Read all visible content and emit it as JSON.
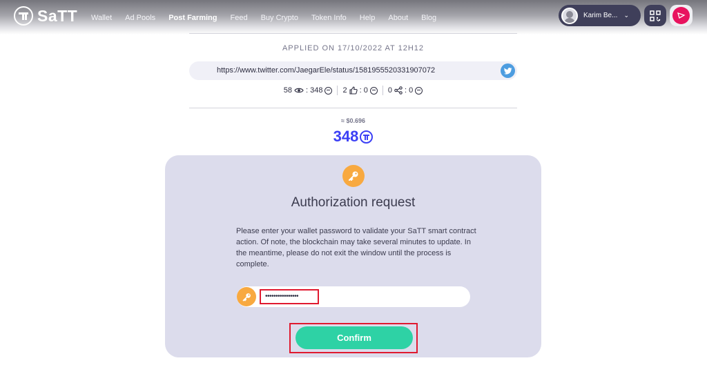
{
  "header": {
    "logo_text": "SaTT",
    "nav": [
      "Wallet",
      "Ad Pools",
      "Post Farming",
      "Feed",
      "Buy Crypto",
      "Token Info",
      "Help",
      "About",
      "Blog"
    ],
    "active_nav": "Post Farming",
    "user_name": "Karim Be...",
    "qr_icon": "qr-code-icon",
    "wallet_icon": "wallet-icon"
  },
  "post": {
    "applied_on": "APPLIED ON 17/10/2022 AT 12H12",
    "url": "https://www.twitter.com/JaegarEle/status/1581955520331907072",
    "network_icon": "twitter-icon",
    "stats": {
      "views": "58",
      "views_reward": "348",
      "likes": "2",
      "likes_reward": "0",
      "shares": "0",
      "shares_reward": "0"
    },
    "usd_value": "≈ $0.696",
    "total_reward": "348"
  },
  "auth": {
    "title": "Authorization request",
    "description": "Please enter your wallet password to validate your SaTT smart contract action. Of note, the blockchain may take several minutes to update. In the meantime, please do not exit the window until the process is complete.",
    "password_value": "••••••••••••••••",
    "confirm_label": "Confirm"
  },
  "colors": {
    "accent_blue": "#3b3ff5",
    "confirm_green": "#2ed2a5",
    "key_orange": "#f8a940",
    "highlight_red": "#e0192f",
    "card_bg": "#dcdcec"
  }
}
